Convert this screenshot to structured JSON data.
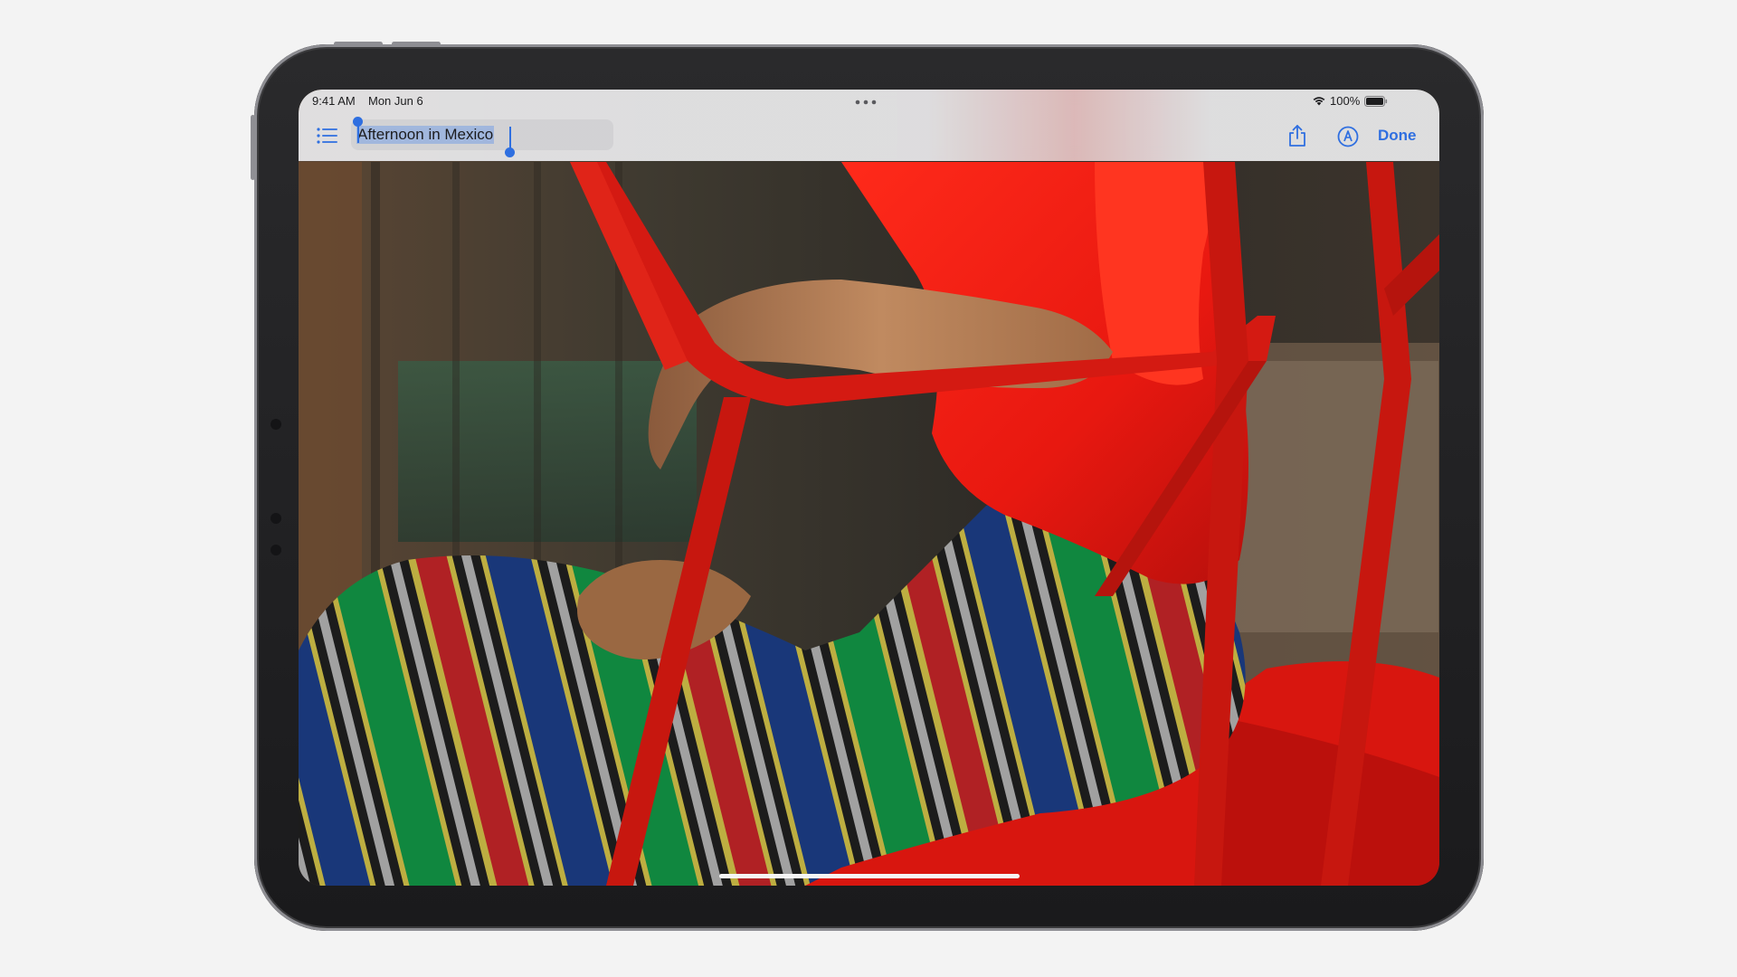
{
  "status_bar": {
    "time": "9:41 AM",
    "date": "Mon Jun 6",
    "battery_percent": "100%",
    "battery_level": 1.0
  },
  "toolbar": {
    "title": "Afternoon in Mexico",
    "done_label": "Done",
    "icons": {
      "list": "list-icon",
      "share": "share-icon",
      "markup": "markup-pen-icon",
      "more": "more-dots-icon",
      "wifi": "wifi-icon",
      "battery": "battery-icon"
    }
  },
  "colors": {
    "accent": "#2f6fe0",
    "selection": "#7aa0e6",
    "device_frame": "#1a1a1c",
    "background": "#f3f3f3"
  }
}
